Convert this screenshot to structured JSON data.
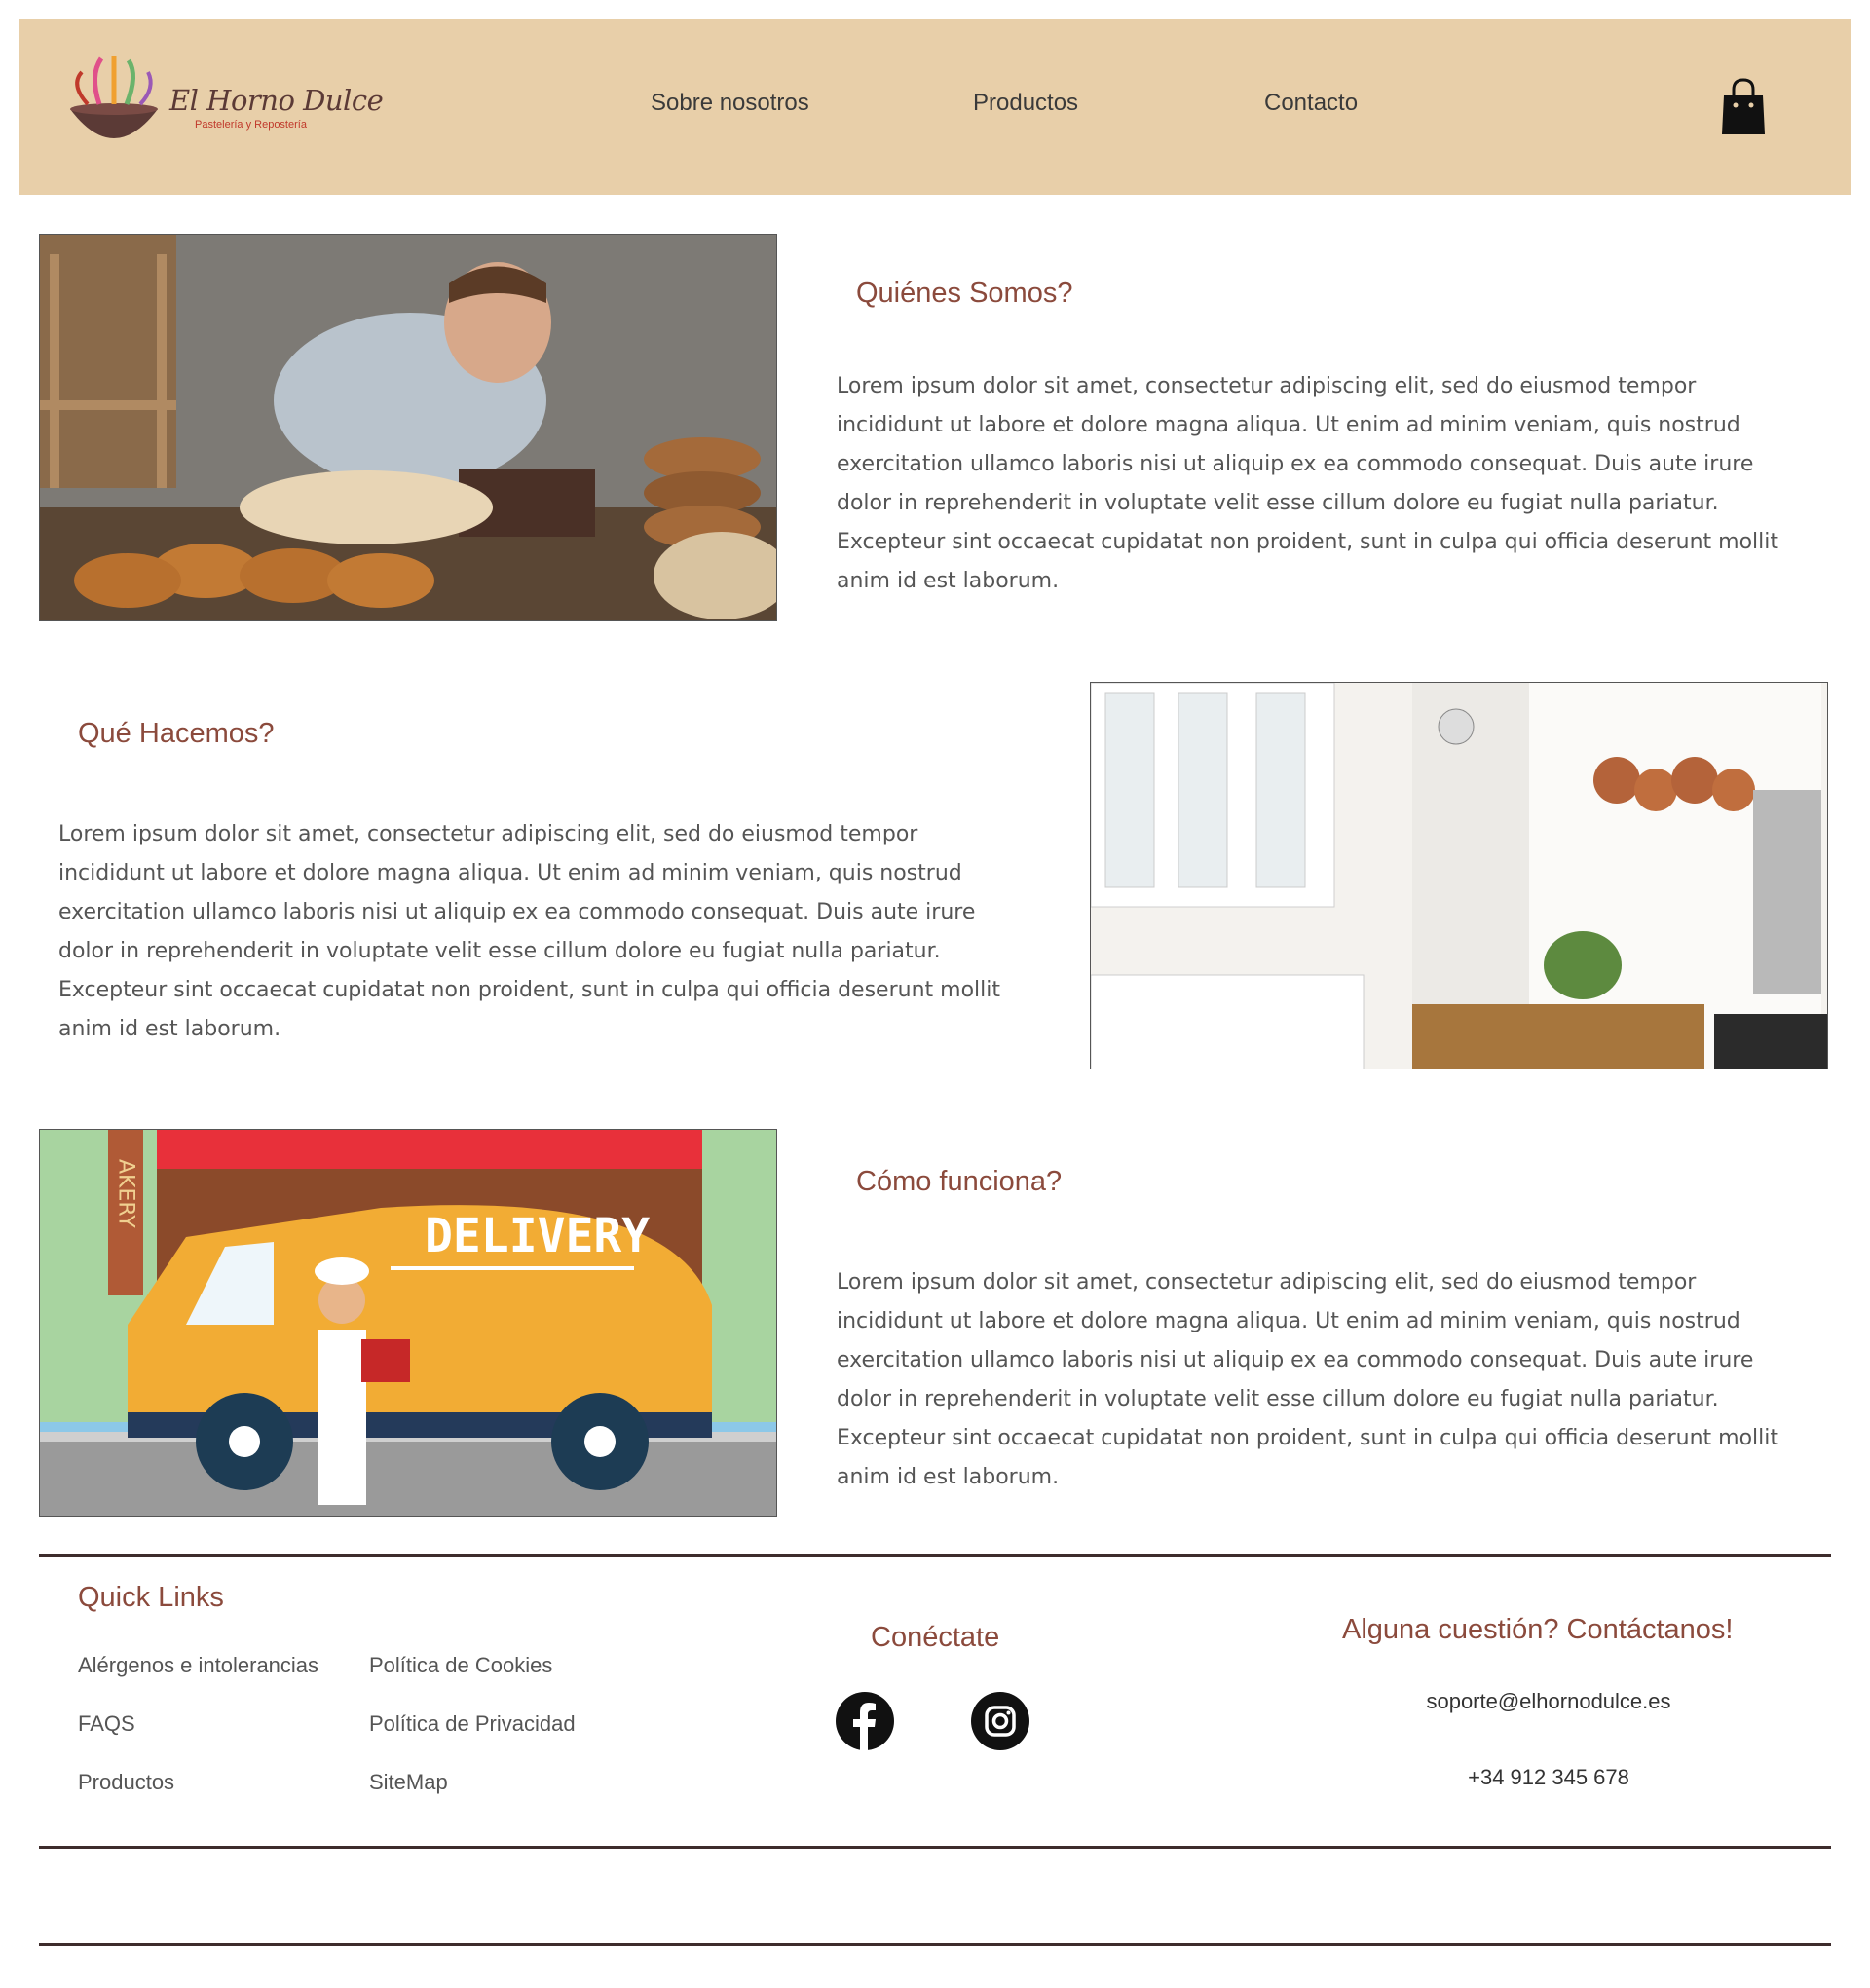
{
  "header": {
    "logo_text": "El Horno Dulce",
    "logo_subtext": "Pastelería y Repostería",
    "nav": [
      "Sobre nosotros",
      "Productos",
      "Contacto"
    ],
    "cart_icon": "shopping-bag-icon",
    "background": "#e8cfa9"
  },
  "sections": [
    {
      "title": "Quiénes Somos?",
      "text": "Lorem ipsum dolor sit amet, consectetur adipiscing elit, sed do eiusmod tempor incididunt ut labore et dolore magna aliqua. Ut enim ad minim veniam, quis nostrud exercitation ullamco laboris nisi ut aliquip ex ea commodo consequat. Duis aute irure dolor in reprehenderit in voluptate velit esse cillum dolore eu fugiat nulla pariatur. Excepteur sint occaecat cupidatat non proident, sunt in culpa qui officia deserunt mollit anim id est laborum.",
      "image_label": "baker-photo"
    },
    {
      "title": "Qué Hacemos?",
      "text": "Lorem ipsum dolor sit amet, consectetur adipiscing elit, sed do eiusmod tempor incididunt ut labore et dolore magna aliqua. Ut enim ad minim veniam, quis nostrud exercitation ullamco laboris nisi ut aliquip ex ea commodo consequat. Duis aute irure dolor in reprehenderit in voluptate velit esse cillum dolore eu fugiat nulla pariatur. Excepteur sint occaecat cupidatat non proident, sunt in culpa qui officia deserunt mollit anim id est laborum.",
      "image_label": "kitchen-photo"
    },
    {
      "title": "Cómo funciona?",
      "text": "Lorem ipsum dolor sit amet, consectetur adipiscing elit, sed do eiusmod tempor incididunt ut labore et dolore magna aliqua. Ut enim ad minim veniam, quis nostrud exercitation ullamco laboris nisi ut aliquip ex ea commodo consequat. Duis aute irure dolor in reprehenderit in voluptate velit esse cillum dolore eu fugiat nulla pariatur. Excepteur sint occaecat cupidatat non proident, sunt in culpa qui officia deserunt mollit anim id est laborum.",
      "image_label": "delivery-illustration",
      "image_text_delivery": "DELIVERY",
      "image_text_bakery": "AKERY"
    }
  ],
  "footer": {
    "quick_links_title": "Quick Links",
    "links_col1": [
      "Alérgenos e intolerancias",
      "FAQS",
      "Productos"
    ],
    "links_col2": [
      "Política de Cookies",
      "Política de Privacidad",
      "SiteMap"
    ],
    "connect_title": "Conéctate",
    "social_icons": [
      "facebook-icon",
      "instagram-icon"
    ],
    "contact_title": "Alguna cuestión? Contáctanos!",
    "email": "soporte@elhornodulce.es",
    "phone": "+34 912 345 678"
  },
  "colors": {
    "accent_title": "#8b4a3c",
    "rule": "#3d2c2c",
    "body_text": "#555555"
  }
}
